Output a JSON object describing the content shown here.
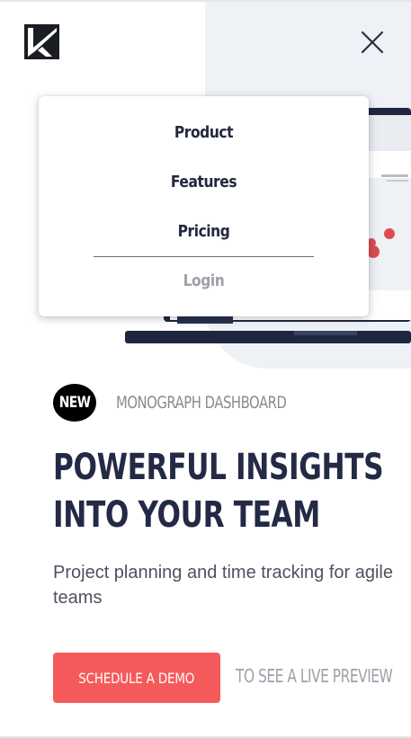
{
  "header": {
    "logo": {
      "icon": "k-logo-icon"
    },
    "close": {
      "icon": "close-icon"
    }
  },
  "menu": {
    "items": [
      {
        "label": "Product"
      },
      {
        "label": "Features"
      },
      {
        "label": "Pricing"
      }
    ],
    "login_label": "Login"
  },
  "hero": {
    "badge": "NEW",
    "badge_label": "MONOGRAPH DASHBOARD",
    "headline_line1": "POWERFUL INSIGHTS",
    "headline_line2": "INTO YOUR TEAM",
    "subtext": "Project planning and time tracking for agile teams",
    "cta_label": "SCHEDULE A DEMO",
    "preview_link": "TO SEE A LIVE PREVIEW"
  },
  "colors": {
    "brand_red": "#f55a5a",
    "heading_navy": "#232a45",
    "hero_background": "#eef2f6",
    "muted_text": "#878b93"
  }
}
